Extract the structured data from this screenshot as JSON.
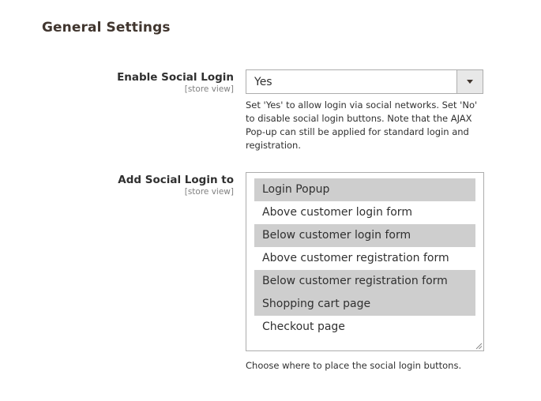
{
  "section": {
    "title": "General Settings"
  },
  "enable_social_login": {
    "label": "Enable Social Login",
    "scope": "[store view]",
    "value": "Yes",
    "note": "Set 'Yes' to allow login via social networks. Set 'No' to disable social login buttons. Note that the AJAX Pop-up can still be applied for standard login and registration."
  },
  "add_social_login": {
    "label": "Add Social Login to",
    "scope": "[store view]",
    "options": [
      {
        "label": "Login Popup",
        "selected": true
      },
      {
        "label": "Above customer login form",
        "selected": false
      },
      {
        "label": "Below customer login form",
        "selected": true
      },
      {
        "label": "Above customer registration form",
        "selected": false
      },
      {
        "label": "Below customer registration form",
        "selected": true
      },
      {
        "label": "Shopping cart page",
        "selected": true
      },
      {
        "label": "Checkout page",
        "selected": false
      }
    ],
    "note": "Choose where to place the social login buttons."
  },
  "icons": {
    "select_arrow": "chevron-down-icon",
    "resize": "resize-grip-icon"
  },
  "colors": {
    "selected_option_bg": "#cecece",
    "border": "#adadad",
    "title": "#41362f"
  }
}
